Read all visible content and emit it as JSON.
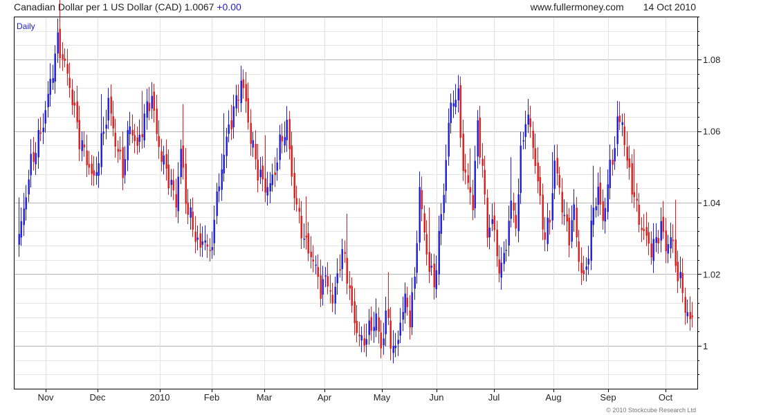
{
  "header": {
    "title": "Canadian Dollar per 1 US Dollar (CAD) 1.0067",
    "change": "+0.00",
    "site": "www.fullermoney.com",
    "date": "14 Oct 2010"
  },
  "footer": {
    "copyright": "© 2010 Stockcube Research Ltd"
  },
  "colors": {
    "up": "#1a1adf",
    "down": "#e01818",
    "grid": "#cccccc",
    "axis": "#000000"
  },
  "chart_data": {
    "type": "candlestick-bars",
    "period_label": "Daily",
    "y_ticks": [
      "1",
      "1.02",
      "1.04",
      "1.06",
      "1.08"
    ],
    "x_ticks": [
      "Nov",
      "Dec",
      "2010",
      "Feb",
      "Mar",
      "Apr",
      "May",
      "Jun",
      "Jul",
      "Aug",
      "Sep",
      "Oct"
    ],
    "ylim": [
      0.988,
      1.092
    ],
    "grid": true,
    "series": [
      {
        "x": 0,
        "y": 1.03
      },
      {
        "x": 5,
        "y": 1.051
      },
      {
        "x": 10,
        "y": 1.062
      },
      {
        "x": 16,
        "y": 1.085
      },
      {
        "x": 20,
        "y": 1.076
      },
      {
        "x": 25,
        "y": 1.058
      },
      {
        "x": 28,
        "y": 1.052
      },
      {
        "x": 31,
        "y": 1.046
      },
      {
        "x": 35,
        "y": 1.06
      },
      {
        "x": 37,
        "y": 1.068
      },
      {
        "x": 40,
        "y": 1.057
      },
      {
        "x": 43,
        "y": 1.049
      },
      {
        "x": 46,
        "y": 1.062
      },
      {
        "x": 49,
        "y": 1.055
      },
      {
        "x": 52,
        "y": 1.064
      },
      {
        "x": 55,
        "y": 1.07
      },
      {
        "x": 57,
        "y": 1.059
      },
      {
        "x": 59,
        "y": 1.053
      },
      {
        "x": 62,
        "y": 1.047
      },
      {
        "x": 65,
        "y": 1.04
      },
      {
        "x": 67,
        "y": 1.055
      },
      {
        "x": 69,
        "y": 1.041
      },
      {
        "x": 72,
        "y": 1.033
      },
      {
        "x": 75,
        "y": 1.027
      },
      {
        "x": 77,
        "y": 1.031
      },
      {
        "x": 79,
        "y": 1.024
      },
      {
        "x": 81,
        "y": 1.036
      },
      {
        "x": 84,
        "y": 1.05
      },
      {
        "x": 87,
        "y": 1.061
      },
      {
        "x": 90,
        "y": 1.068
      },
      {
        "x": 92,
        "y": 1.074
      },
      {
        "x": 94,
        "y": 1.068
      },
      {
        "x": 96,
        "y": 1.058
      },
      {
        "x": 99,
        "y": 1.049
      },
      {
        "x": 102,
        "y": 1.044
      },
      {
        "x": 105,
        "y": 1.046
      },
      {
        "x": 108,
        "y": 1.056
      },
      {
        "x": 111,
        "y": 1.062
      },
      {
        "x": 113,
        "y": 1.047
      },
      {
        "x": 116,
        "y": 1.035
      },
      {
        "x": 119,
        "y": 1.028
      },
      {
        "x": 122,
        "y": 1.024
      },
      {
        "x": 125,
        "y": 1.016
      },
      {
        "x": 128,
        "y": 1.019
      },
      {
        "x": 130,
        "y": 1.011
      },
      {
        "x": 132,
        "y": 1.021
      },
      {
        "x": 135,
        "y": 1.026
      },
      {
        "x": 137,
        "y": 1.014
      },
      {
        "x": 140,
        "y": 1.004
      },
      {
        "x": 142,
        "y": 1.001
      },
      {
        "x": 145,
        "y": 1.004
      },
      {
        "x": 148,
        "y": 1.008
      },
      {
        "x": 150,
        "y": 0.999
      },
      {
        "x": 152,
        "y": 1.009
      },
      {
        "x": 154,
        "y": 1.002
      },
      {
        "x": 156,
        "y": 0.998
      },
      {
        "x": 158,
        "y": 1.007
      },
      {
        "x": 160,
        "y": 1.013
      },
      {
        "x": 162,
        "y": 1.008
      },
      {
        "x": 164,
        "y": 1.018
      },
      {
        "x": 166,
        "y": 1.044
      },
      {
        "x": 168,
        "y": 1.031
      },
      {
        "x": 170,
        "y": 1.022
      },
      {
        "x": 172,
        "y": 1.017
      },
      {
        "x": 174,
        "y": 1.03
      },
      {
        "x": 176,
        "y": 1.043
      },
      {
        "x": 178,
        "y": 1.062
      },
      {
        "x": 180,
        "y": 1.07
      },
      {
        "x": 182,
        "y": 1.069
      },
      {
        "x": 184,
        "y": 1.05
      },
      {
        "x": 186,
        "y": 1.045
      },
      {
        "x": 188,
        "y": 1.04
      },
      {
        "x": 190,
        "y": 1.061
      },
      {
        "x": 192,
        "y": 1.05
      },
      {
        "x": 194,
        "y": 1.031
      },
      {
        "x": 196,
        "y": 1.036
      },
      {
        "x": 198,
        "y": 1.025
      },
      {
        "x": 200,
        "y": 1.021
      },
      {
        "x": 202,
        "y": 1.029
      },
      {
        "x": 204,
        "y": 1.04
      },
      {
        "x": 206,
        "y": 1.034
      },
      {
        "x": 208,
        "y": 1.053
      },
      {
        "x": 210,
        "y": 1.064
      },
      {
        "x": 212,
        "y": 1.061
      },
      {
        "x": 214,
        "y": 1.051
      },
      {
        "x": 216,
        "y": 1.04
      },
      {
        "x": 218,
        "y": 1.03
      },
      {
        "x": 220,
        "y": 1.036
      },
      {
        "x": 222,
        "y": 1.051
      },
      {
        "x": 224,
        "y": 1.044
      },
      {
        "x": 226,
        "y": 1.035
      },
      {
        "x": 228,
        "y": 1.031
      },
      {
        "x": 230,
        "y": 1.038
      },
      {
        "x": 232,
        "y": 1.024
      },
      {
        "x": 234,
        "y": 1.018
      },
      {
        "x": 236,
        "y": 1.027
      },
      {
        "x": 238,
        "y": 1.038
      },
      {
        "x": 240,
        "y": 1.044
      },
      {
        "x": 242,
        "y": 1.034
      },
      {
        "x": 244,
        "y": 1.046
      },
      {
        "x": 246,
        "y": 1.052
      },
      {
        "x": 248,
        "y": 1.062
      },
      {
        "x": 250,
        "y": 1.063
      },
      {
        "x": 252,
        "y": 1.051
      },
      {
        "x": 254,
        "y": 1.045
      },
      {
        "x": 256,
        "y": 1.038
      },
      {
        "x": 258,
        "y": 1.033
      },
      {
        "x": 260,
        "y": 1.03
      },
      {
        "x": 262,
        "y": 1.027
      },
      {
        "x": 264,
        "y": 1.029
      },
      {
        "x": 266,
        "y": 1.034
      },
      {
        "x": 268,
        "y": 1.027
      },
      {
        "x": 270,
        "y": 1.031
      },
      {
        "x": 272,
        "y": 1.023
      },
      {
        "x": 274,
        "y": 1.018
      },
      {
        "x": 276,
        "y": 1.011
      },
      {
        "x": 278,
        "y": 1.007
      }
    ]
  }
}
